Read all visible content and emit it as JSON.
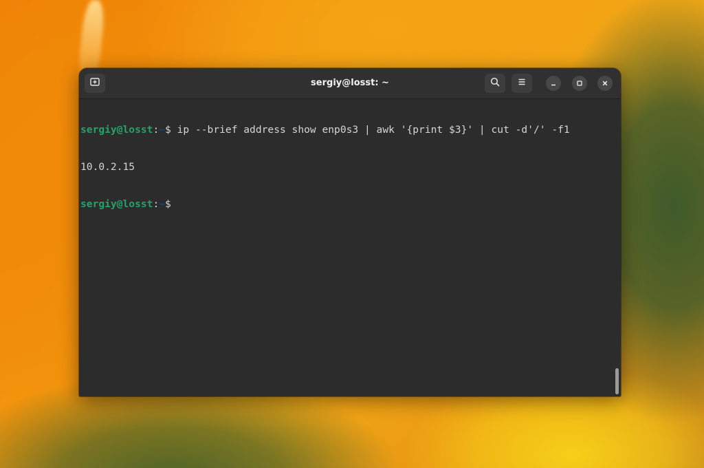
{
  "window": {
    "title": "sergiy@losst: ~"
  },
  "headerbar": {
    "new_tab_icon": "new-tab-icon",
    "search_icon": "search-icon",
    "menu_icon": "hamburger-menu-icon",
    "minimize_icon": "minimize-icon",
    "maximize_icon": "maximize-icon",
    "close_icon": "close-icon"
  },
  "terminal": {
    "lines": [
      {
        "user_host": "sergiy@losst",
        "separator": ":",
        "path": "~",
        "symbol": "$",
        "command": " ip --brief address show enp0s3 | awk '{print $3}' | cut -d'/' -f1"
      },
      {
        "output": "10.0.2.15"
      },
      {
        "user_host": "sergiy@losst",
        "separator": ":",
        "path": "~",
        "symbol": "$",
        "command": " "
      }
    ]
  },
  "colors": {
    "prompt_user": "#26a269",
    "prompt_path": "#12488b",
    "terminal_bg": "#2c2c2c",
    "terminal_fg": "#d6d6d6"
  }
}
